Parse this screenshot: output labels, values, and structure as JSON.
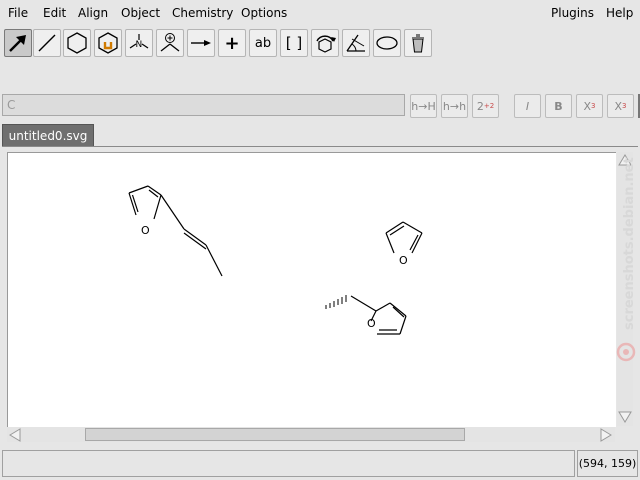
{
  "menu": {
    "file": "File",
    "edit": "Edit",
    "align": "Align",
    "object": "Object",
    "chemistry": "Chemistry",
    "options": "Options",
    "plugins": "Plugins",
    "help": "Help"
  },
  "toolbar": {
    "tools": [
      {
        "name": "edit-mode-tool",
        "icon": "arrow-icon",
        "selected": true
      },
      {
        "name": "bond-tool",
        "icon": "bond-line-icon"
      },
      {
        "name": "ring-tool",
        "icon": "hexagon-icon"
      },
      {
        "name": "template-tool",
        "icon": "template-ring-icon"
      },
      {
        "name": "vector-tool",
        "icon": "nitrogen-atom-icon"
      },
      {
        "name": "charge-tool",
        "icon": "charge-plus-icon"
      },
      {
        "name": "arrow-tool",
        "icon": "reaction-arrow-icon"
      },
      {
        "name": "plus-tool",
        "icon": "plus-icon"
      },
      {
        "name": "text-tool",
        "icon": "text-ab-icon"
      },
      {
        "name": "bracket-tool",
        "icon": "brackets-icon"
      },
      {
        "name": "rotate-tool",
        "icon": "rotate-icon"
      },
      {
        "name": "bond-align-tool",
        "icon": "angle-icon"
      },
      {
        "name": "shape-tool",
        "icon": "ellipse-icon"
      },
      {
        "name": "delete-tool",
        "icon": "bucket-icon"
      }
    ],
    "plus_label": "+",
    "text_label": "ab",
    "bracket_label": "[ ]"
  },
  "text_toolbar": {
    "entry_value": "C",
    "btn_subscript_mode": "h→H",
    "btn_superscript_mode": "h→h",
    "btn_numbering": "2",
    "btn_numbering_sub": "+2",
    "italic": "I",
    "bold": "B",
    "subscript": "X",
    "subscript_mark": "3",
    "superscript": "X",
    "superscript_mark": "3"
  },
  "tabs": [
    {
      "label": "untitled0.svg",
      "active": true
    }
  ],
  "canvas": {
    "molecules": [
      {
        "name": "furan-butenyl",
        "atom_label": "O"
      },
      {
        "name": "furan",
        "atom_label": "O"
      },
      {
        "name": "methyl-furan",
        "atom_label": "O"
      }
    ]
  },
  "statusbar": {
    "message": "",
    "coords": "(594, 159)"
  },
  "watermark": "screenshots.debian.net"
}
